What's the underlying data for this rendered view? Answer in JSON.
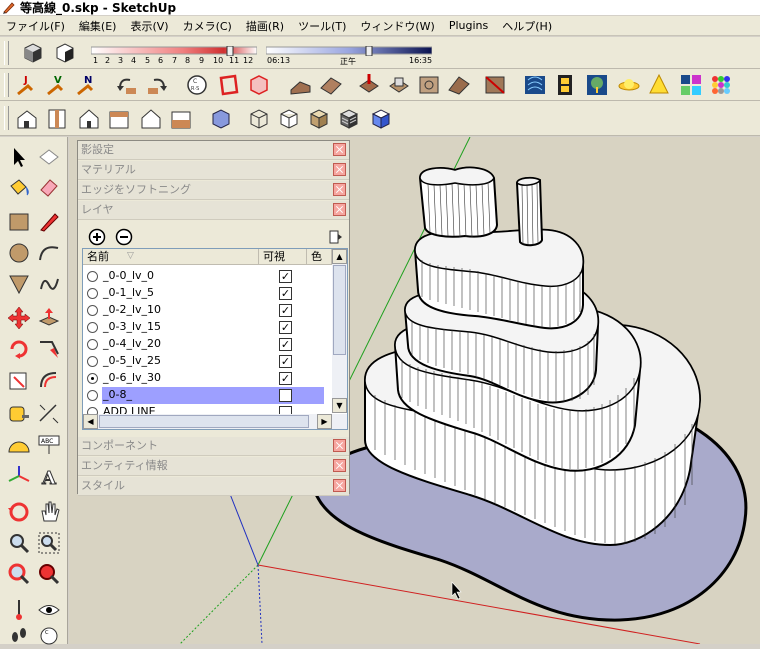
{
  "window": {
    "title": "等高線_0.skp - SketchUp",
    "icon": "sketchup-pencil-icon"
  },
  "menu": [
    "ファイル(F)",
    "編集(E)",
    "表示(V)",
    "カメラ(C)",
    "描画(R)",
    "ツール(T)",
    "ウィンドウ(W)",
    "Plugins",
    "ヘルプ(H)"
  ],
  "shadow_settings": {
    "month_ticks": [
      "1",
      "2",
      "3",
      "4",
      "5",
      "6",
      "7",
      "8",
      "9",
      "10",
      "11",
      "12"
    ],
    "time_start": "06:13",
    "time_noon": "正午",
    "time_end": "16:35"
  },
  "tray": {
    "panels": [
      {
        "title": "影設定"
      },
      {
        "title": "マテリアル"
      },
      {
        "title": "エッジをソフトニング"
      },
      {
        "title": "レイヤ"
      }
    ],
    "bottom_panels": [
      {
        "title": "コンポーネント"
      },
      {
        "title": "エンティティ情報"
      },
      {
        "title": "スタイル"
      }
    ]
  },
  "layers": {
    "columns": {
      "name": "名前",
      "visible": "可視",
      "color": "色"
    },
    "rows": [
      {
        "name": "_0-0_lv_0",
        "active": false,
        "visible": true,
        "selected": false
      },
      {
        "name": "_0-1_lv_5",
        "active": false,
        "visible": true,
        "selected": false
      },
      {
        "name": "_0-2_lv_10",
        "active": false,
        "visible": true,
        "selected": false
      },
      {
        "name": "_0-3_lv_15",
        "active": false,
        "visible": true,
        "selected": false
      },
      {
        "name": "_0-4_lv_20",
        "active": false,
        "visible": true,
        "selected": false
      },
      {
        "name": "_0-5_lv_25",
        "active": false,
        "visible": true,
        "selected": false
      },
      {
        "name": "_0-6_lv_30",
        "active": true,
        "visible": true,
        "selected": false
      },
      {
        "name": "_0-8_",
        "active": false,
        "visible": false,
        "selected": true
      },
      {
        "name": "ADD LINE",
        "active": false,
        "visible": false,
        "selected": false
      }
    ],
    "check_mark": "✓"
  },
  "colors": {
    "viewport_bg": "#d8d3c2",
    "selected_row": "#9d9fff",
    "base_shadow": "#aaaacc"
  }
}
